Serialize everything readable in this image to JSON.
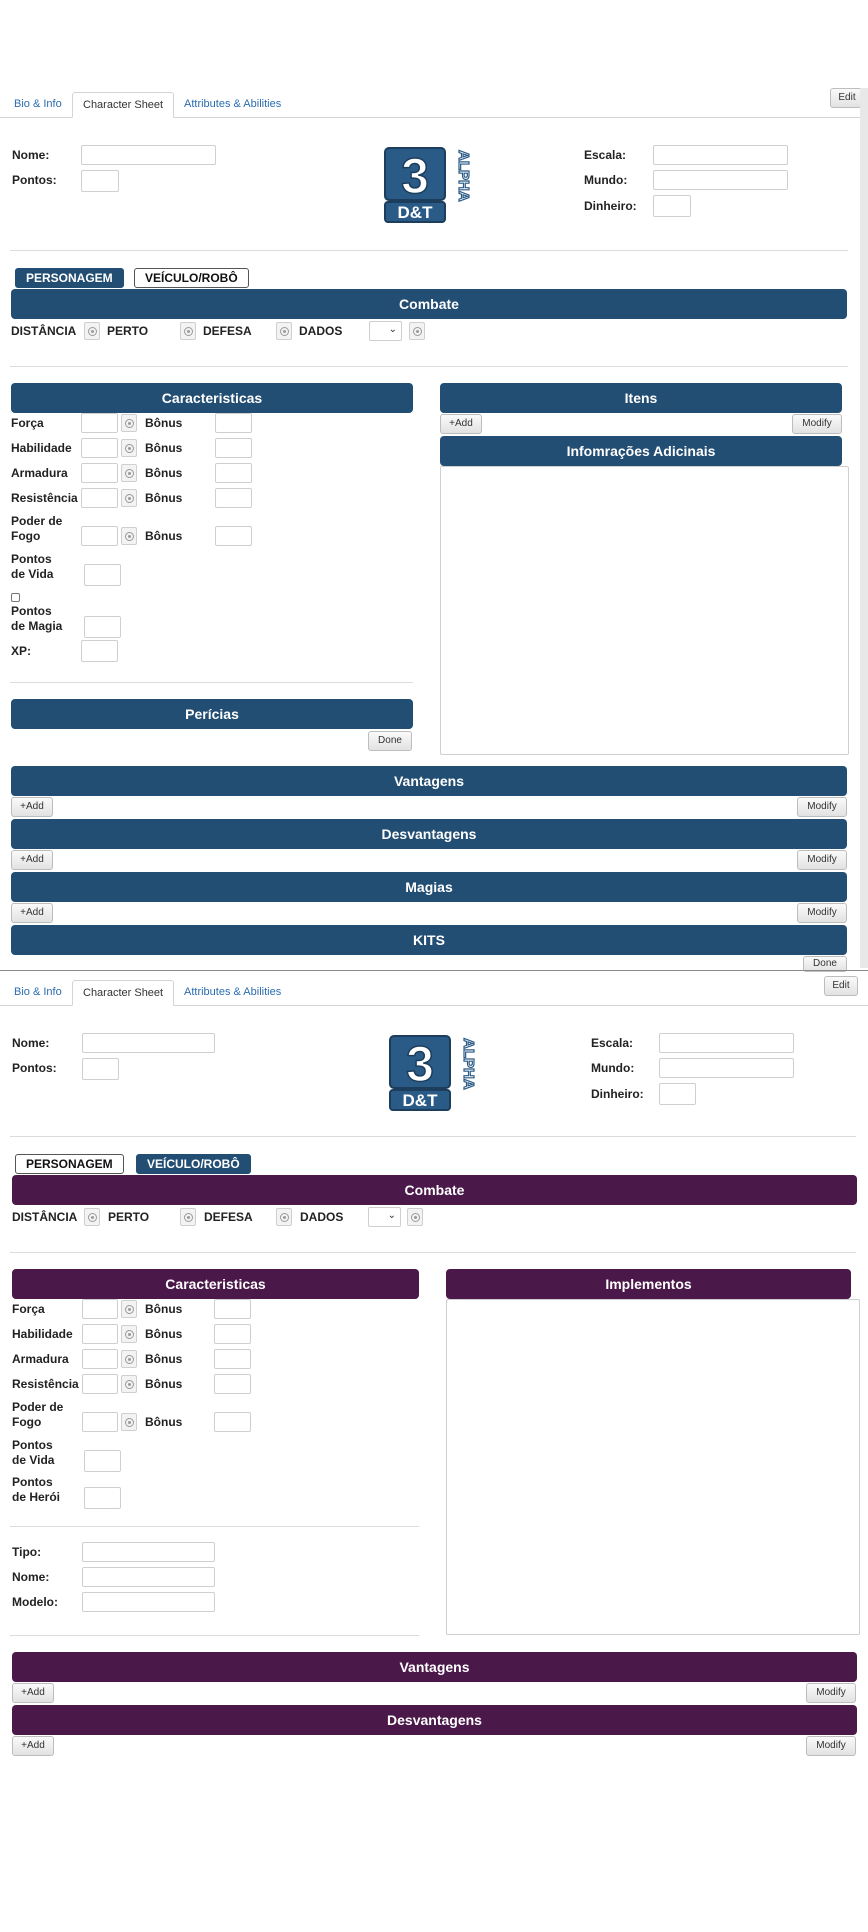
{
  "edit_label": "Edit",
  "tabs": [
    "Bio & Info",
    "Character Sheet",
    "Attributes & Abilities"
  ],
  "identity": {
    "nome_label": "Nome:",
    "pontos_label": "Pontos:",
    "escala_label": "Escala:",
    "mundo_label": "Mundo:",
    "dinheiro_label": "Dinheiro:"
  },
  "logo": {
    "title_text": "3",
    "bottom_text": "D&T",
    "side_text": "ALPHA"
  },
  "mode": {
    "personagem": "PERSONAGEM",
    "veiculo": "VEÍCULO/ROBÔ"
  },
  "combate": {
    "title": "Combate",
    "distancia": "DISTÂNCIA",
    "perto": "PERTO",
    "defesa": "DEFESA",
    "dados": "DADOS",
    "dados_caret": "⌄"
  },
  "caracteristicas": {
    "title": "Caracteristicas",
    "forca": "Força",
    "habilidade": "Habilidade",
    "armadura": "Armadura",
    "resistencia": "Resistência",
    "poder_de_fogo_1": "Poder de",
    "poder_de_fogo_2": "Fogo",
    "bonus": "Bônus",
    "pontos_1": "Pontos",
    "de_vida": "de Vida",
    "de_magia": "de Magia",
    "de_heroi": "de Herói",
    "xp": "XP:"
  },
  "sheet1": {
    "itens_title": "Itens",
    "info_title": "Infomrações Adicinais",
    "pericias_title": "Perícias",
    "done": "Done",
    "add": "+Add",
    "modify": "Modify",
    "vantagens": "Vantagens",
    "desvantagens": "Desvantagens",
    "magias": "Magias",
    "kits": "KITS"
  },
  "sheet2": {
    "implementos_title": "Implementos",
    "tipo": "Tipo:",
    "nome": "Nome:",
    "modelo": "Modelo:",
    "add": "+Add",
    "modify": "Modify",
    "vantagens": "Vantagens",
    "desvantagens": "Desvantagens"
  },
  "colors": {
    "blue_header": "#234e73",
    "purple_header": "#4a1849",
    "tab_link": "#2b6cb0"
  }
}
